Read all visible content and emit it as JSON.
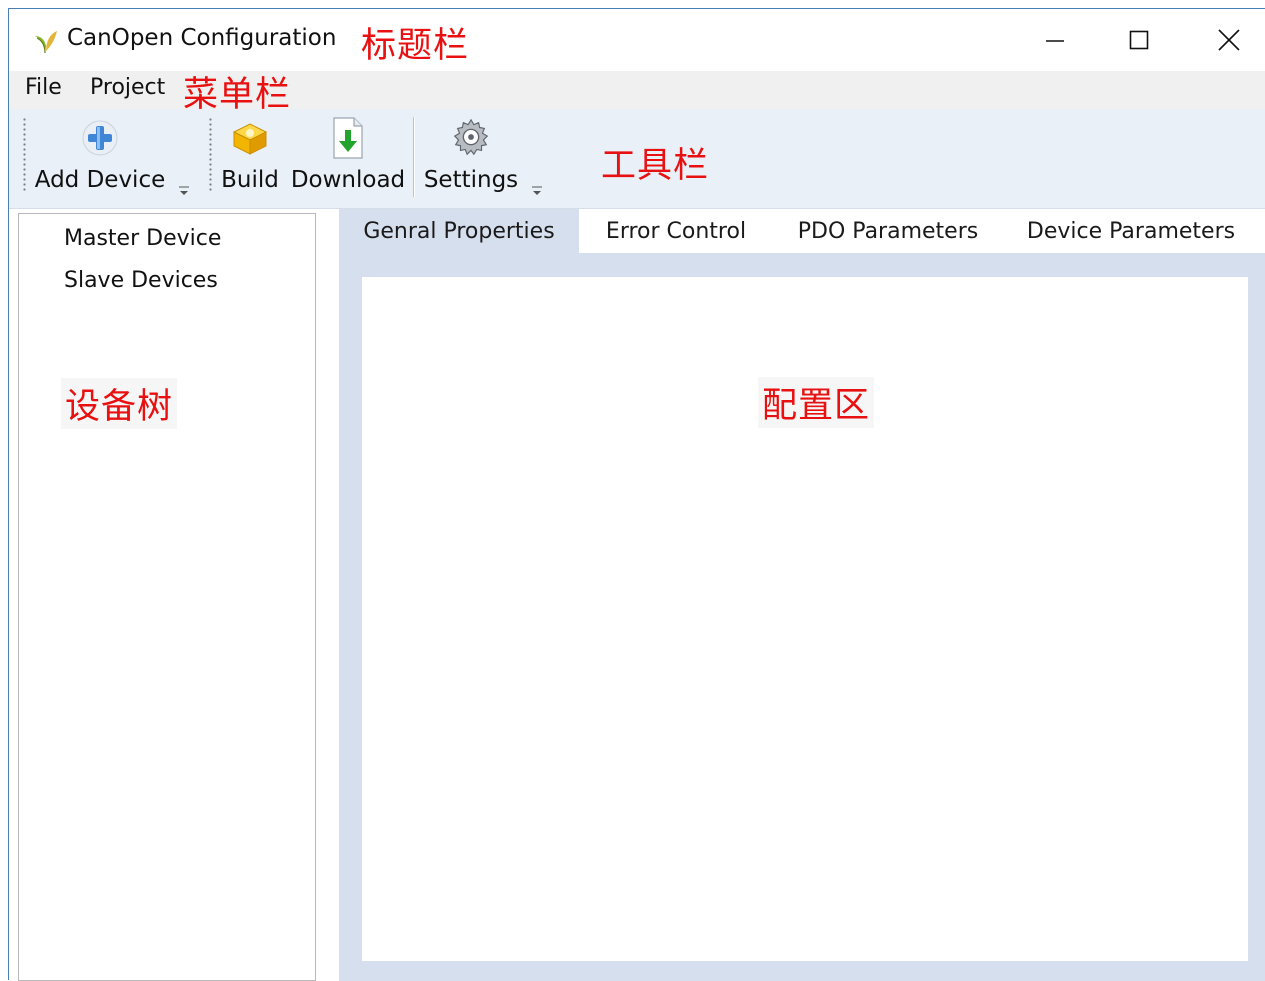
{
  "window": {
    "title": "CanOpen Configuration",
    "app_icon": "sprout-icon",
    "controls": [
      "minimize-icon",
      "maximize-icon",
      "close-icon"
    ]
  },
  "annotations": {
    "title_bar": "标题栏",
    "menu_bar": "菜单栏",
    "toolbar": "工具栏",
    "device_tree": "设备树",
    "config_area": "配置区"
  },
  "menu": {
    "items": [
      "File",
      "Project"
    ]
  },
  "toolbar": {
    "add_device": "Add Device",
    "build": "Build",
    "download": "Download",
    "settings": "Settings"
  },
  "tree": {
    "items": [
      "Master Device",
      "Slave Devices"
    ]
  },
  "tabs": {
    "items": [
      "Genral Properties",
      "Error Control",
      "PDO Parameters",
      "Device Parameters"
    ],
    "active_index": 0
  },
  "colors": {
    "annotation": "#e81010",
    "toolbar_bg": "#e9f0f8",
    "config_bg": "#d6dfee",
    "window_border": "#4a7fb5"
  }
}
